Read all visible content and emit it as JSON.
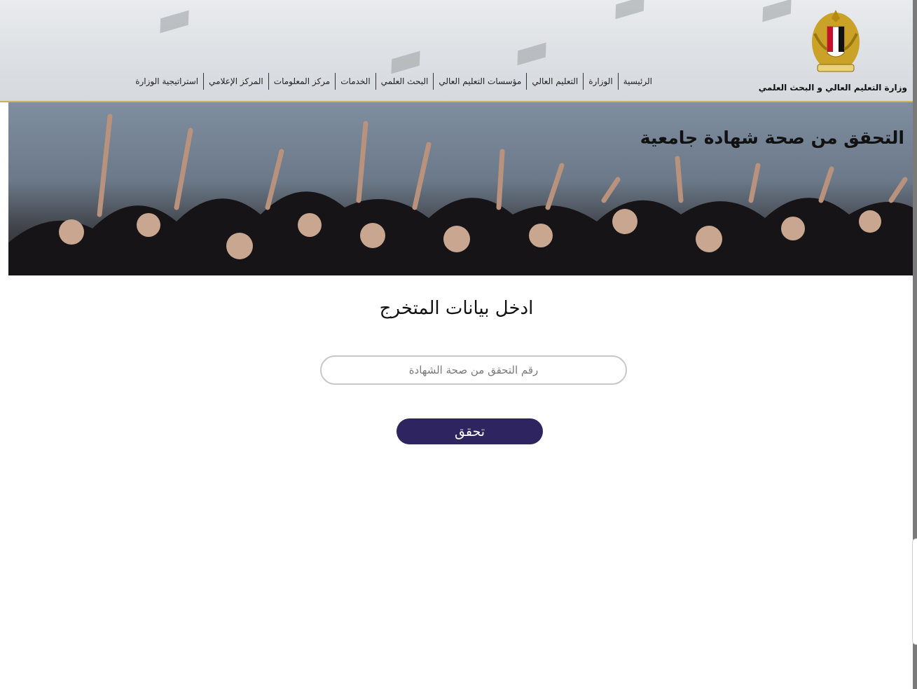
{
  "header": {
    "ministry_name": "وزارة التعليم العالي و البحث العلمي",
    "nav": [
      "الرئيسية",
      "الوزارة",
      "التعليم العالي",
      "مؤسسات التعليم العالي",
      "البحث العلمي",
      "الخدمات",
      "مركز المعلومات",
      "المركز الإعلامي",
      "استراتيجية الوزارة"
    ]
  },
  "banner": {
    "title": "التحقق من صحة شهادة جامعية"
  },
  "form": {
    "title": "ادخل بيانات المتخرج",
    "input_placeholder": "رقم التحقق من صحة الشهادة",
    "input_value": "",
    "submit_label": "تحقق"
  },
  "colors": {
    "button": "#2e2560",
    "header_border": "#c9b458",
    "header_bg": "#dcdfe3"
  },
  "icons": {
    "logo": "egypt-eagle-emblem"
  }
}
